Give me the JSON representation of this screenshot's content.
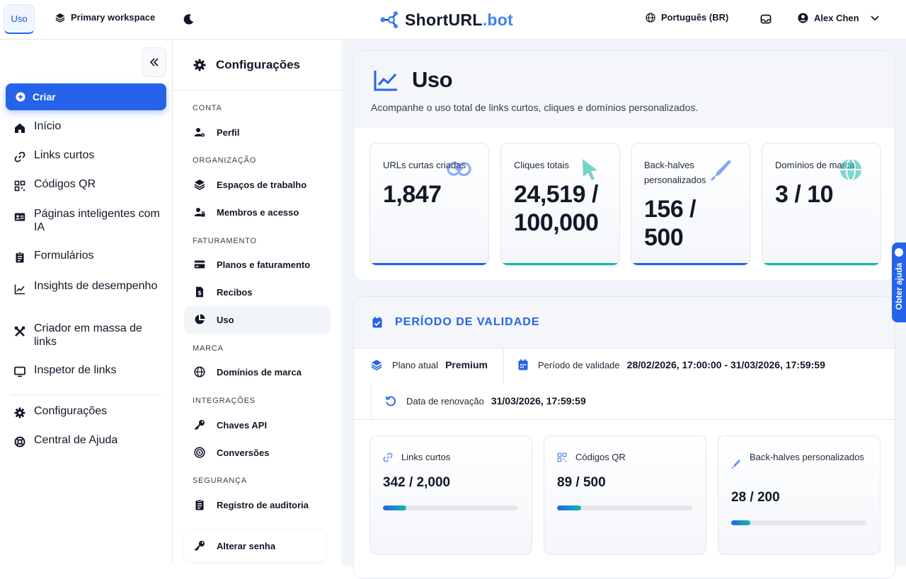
{
  "topbar": {
    "usage_tab": "Uso",
    "workspace": "Primary workspace",
    "brand_main": "ShortURL",
    "brand_suffix": ".bot",
    "language": "Português (BR)",
    "user": "Alex Chen"
  },
  "sidebar": {
    "create": "Criar",
    "items": [
      {
        "label": "Início",
        "icon": "home-icon"
      },
      {
        "label": "Links curtos",
        "icon": "link-icon"
      },
      {
        "label": "Códigos QR",
        "icon": "qr-icon"
      },
      {
        "label": "Páginas inteligentes com IA",
        "icon": "id-card-icon"
      },
      {
        "label": "Formulários",
        "icon": "clipboard-icon"
      },
      {
        "label": "Insights de desempenho",
        "icon": "chart-line-icon"
      },
      {
        "label": "Criador em massa de links",
        "icon": "tools-icon"
      },
      {
        "label": "Inspetor de links",
        "icon": "monitor-icon"
      },
      {
        "label": "Configurações",
        "icon": "gear-icon"
      },
      {
        "label": "Central de Ajuda",
        "icon": "lifebuoy-icon"
      }
    ]
  },
  "settings": {
    "title": "Configurações",
    "sections": {
      "conta": "CONTA",
      "organizacao": "ORGANIZAÇÃO",
      "faturamento": "FATURAMENTO",
      "marca": "MARCA",
      "integracoes": "INTEGRAÇÕES",
      "seguranca": "SEGURANÇA"
    },
    "items": {
      "perfil": "Perfil",
      "espacos": "Espaços de trabalho",
      "membros": "Membros e acesso",
      "planos": "Planos e faturamento",
      "recibos": "Recibos",
      "uso": "Uso",
      "dominios": "Domínios de marca",
      "chaves": "Chaves API",
      "conversoes": "Conversões",
      "auditoria": "Registro de auditoria"
    },
    "change_password": "Alterar senha"
  },
  "usage": {
    "title": "Uso",
    "subtitle": "Acompanhe o uso total de links curtos, cliques e domínios personalizados.",
    "stats": [
      {
        "label": "URLs curtas criadas",
        "value_line1": "1,847",
        "value_line2": "",
        "accent": "#2563eb"
      },
      {
        "label": "Cliques totais",
        "value_line1": "24,519 /",
        "value_line2": "100,000",
        "accent": "#14b8a6"
      },
      {
        "label": "Back-halves personalizados",
        "value_line1": "156 /",
        "value_line2": "500",
        "accent": "#2563eb"
      },
      {
        "label": "Domínios de marca",
        "value_line1": "3 / 10",
        "value_line2": "",
        "accent": "#14b8a6"
      }
    ]
  },
  "period": {
    "title": "PERÍODO DE VALIDADE",
    "plan_label": "Plano atual",
    "plan_value": "Premium",
    "validity_label": "Período de validade",
    "validity_value": "28/02/2026, 17:00:00 - 31/03/2026, 17:59:59",
    "renewal_label": "Data de renovação",
    "renewal_value": "31/03/2026, 17:59:59",
    "cards": [
      {
        "label": "Links curtos",
        "value": "342 / 2,000",
        "fraction": 0.171,
        "icon": "link-icon"
      },
      {
        "label": "Códigos QR",
        "value": "89 / 500",
        "fraction": 0.178,
        "icon": "qr-icon"
      },
      {
        "label": "Back-halves personalizados",
        "value": "28 / 200",
        "fraction": 0.14,
        "icon": "pen-icon"
      }
    ]
  },
  "help_tab": "Obter ajuda"
}
